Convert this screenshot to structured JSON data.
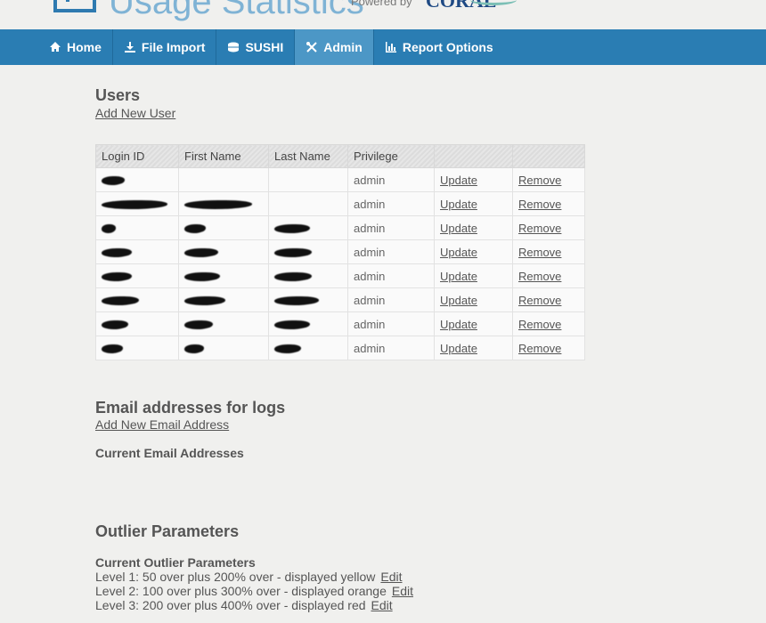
{
  "header": {
    "title": "Usage Statistics",
    "powered_by": "Powered by",
    "brand": "CORAL"
  },
  "nav": [
    {
      "label": "Home",
      "icon": "home-icon"
    },
    {
      "label": "File Import",
      "icon": "download-icon"
    },
    {
      "label": "SUSHI",
      "icon": "database-icon"
    },
    {
      "label": "Admin",
      "icon": "tools-icon",
      "active": true
    },
    {
      "label": "Report Options",
      "icon": "bar-chart-icon"
    }
  ],
  "users": {
    "title": "Users",
    "add_link": "Add New User",
    "columns": [
      "Login ID",
      "First Name",
      "Last Name",
      "Privilege",
      "",
      ""
    ],
    "rows": [
      {
        "privilege": "admin",
        "update": "Update",
        "remove": "Remove"
      },
      {
        "privilege": "admin",
        "update": "Update",
        "remove": "Remove"
      },
      {
        "privilege": "admin",
        "update": "Update",
        "remove": "Remove"
      },
      {
        "privilege": "admin",
        "update": "Update",
        "remove": "Remove"
      },
      {
        "privilege": "admin",
        "update": "Update",
        "remove": "Remove"
      },
      {
        "privilege": "admin",
        "update": "Update",
        "remove": "Remove"
      },
      {
        "privilege": "admin",
        "update": "Update",
        "remove": "Remove"
      },
      {
        "privilege": "admin",
        "update": "Update",
        "remove": "Remove"
      }
    ]
  },
  "email": {
    "title": "Email addresses for logs",
    "add_link": "Add New Email Address",
    "current_label": "Current Email Addresses"
  },
  "outlier": {
    "title": "Outlier Parameters",
    "current_label": "Current Outlier Parameters",
    "levels": [
      {
        "text": "Level 1: 50 over plus 200% over - displayed yellow",
        "edit": "Edit"
      },
      {
        "text": "Level 2: 100 over plus 300% over - displayed orange",
        "edit": "Edit"
      },
      {
        "text": "Level 3: 200 over plus 400% over - displayed red",
        "edit": "Edit"
      }
    ]
  }
}
